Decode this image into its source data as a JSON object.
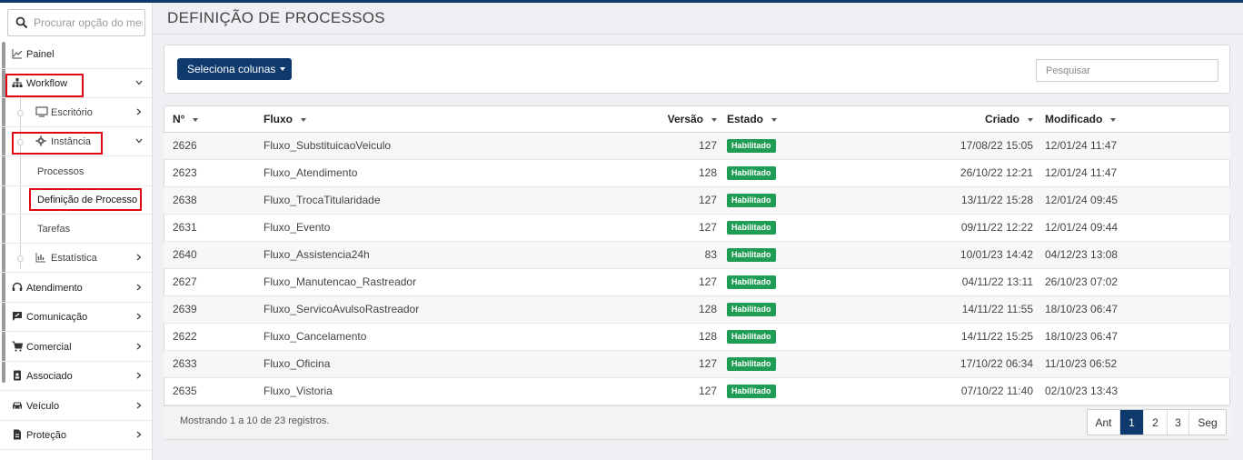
{
  "sidebar": {
    "search_placeholder": "Procurar opção do menu",
    "items": [
      {
        "label": "Painel"
      },
      {
        "label": "Workflow"
      },
      {
        "label": "Escritório"
      },
      {
        "label": "Instância"
      },
      {
        "label": "Processos"
      },
      {
        "label": "Definição de Processo"
      },
      {
        "label": "Tarefas"
      },
      {
        "label": "Estatística"
      },
      {
        "label": "Atendimento"
      },
      {
        "label": "Comunicação"
      },
      {
        "label": "Comercial"
      },
      {
        "label": "Associado"
      },
      {
        "label": "Veículo"
      },
      {
        "label": "Proteção"
      }
    ]
  },
  "page": {
    "title": "DEFINIÇÃO DE PROCESSOS",
    "select_columns_label": "Seleciona colunas",
    "search_placeholder": "Pesquisar"
  },
  "table": {
    "headers": [
      "N°",
      "Fluxo",
      "Versão",
      "Estado",
      "Criado",
      "Modificado"
    ],
    "rows": [
      {
        "n": "2626",
        "fluxo": "Fluxo_SubstituicaoVeiculo",
        "versao": "127",
        "estado": "Habilitado",
        "criado": "17/08/22 15:05",
        "modificado": "12/01/24 11:47"
      },
      {
        "n": "2623",
        "fluxo": "Fluxo_Atendimento",
        "versao": "128",
        "estado": "Habilitado",
        "criado": "26/10/22 12:21",
        "modificado": "12/01/24 11:47"
      },
      {
        "n": "2638",
        "fluxo": "Fluxo_TrocaTitularidade",
        "versao": "127",
        "estado": "Habilitado",
        "criado": "13/11/22 15:28",
        "modificado": "12/01/24 09:45"
      },
      {
        "n": "2631",
        "fluxo": "Fluxo_Evento",
        "versao": "127",
        "estado": "Habilitado",
        "criado": "09/11/22 12:22",
        "modificado": "12/01/24 09:44"
      },
      {
        "n": "2640",
        "fluxo": "Fluxo_Assistencia24h",
        "versao": "83",
        "estado": "Habilitado",
        "criado": "10/01/23 14:42",
        "modificado": "04/12/23 13:08"
      },
      {
        "n": "2627",
        "fluxo": "Fluxo_Manutencao_Rastreador",
        "versao": "127",
        "estado": "Habilitado",
        "criado": "04/11/22 13:11",
        "modificado": "26/10/23 07:02"
      },
      {
        "n": "2639",
        "fluxo": "Fluxo_ServicoAvulsoRastreador",
        "versao": "128",
        "estado": "Habilitado",
        "criado": "14/11/22 11:55",
        "modificado": "18/10/23 06:47"
      },
      {
        "n": "2622",
        "fluxo": "Fluxo_Cancelamento",
        "versao": "128",
        "estado": "Habilitado",
        "criado": "14/11/22 15:25",
        "modificado": "18/10/23 06:47"
      },
      {
        "n": "2633",
        "fluxo": "Fluxo_Oficina",
        "versao": "127",
        "estado": "Habilitado",
        "criado": "17/10/22 06:34",
        "modificado": "11/10/23 06:52"
      },
      {
        "n": "2635",
        "fluxo": "Fluxo_Vistoria",
        "versao": "127",
        "estado": "Habilitado",
        "criado": "07/10/22 11:40",
        "modificado": "02/10/23 13:43"
      }
    ],
    "showing_text": "Mostrando 1 a 10 de 23 registros."
  },
  "pagination": {
    "prev": "Ant",
    "pages": [
      "1",
      "2",
      "3"
    ],
    "next": "Seg",
    "current": "1"
  },
  "colors": {
    "primary": "#0f3a6e",
    "badge": "#1f9d55",
    "highlight": "#e30613"
  }
}
